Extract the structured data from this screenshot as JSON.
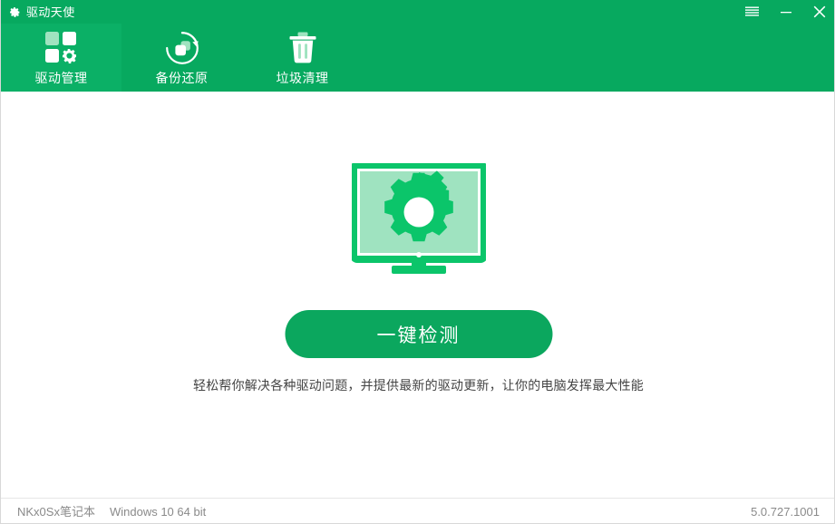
{
  "app": {
    "title": "驱动天使",
    "title_icon": "gear-icon",
    "accent_green": "#07a95f",
    "active_tab_green": "#0bb066",
    "button_green": "#0ba75e",
    "icon_bright_green": "#0bc56a",
    "icon_light_green": "#9fe3c0"
  },
  "window_controls": {
    "menu": "menu-icon",
    "minimize": "minimize-icon",
    "close": "close-icon"
  },
  "tabs": [
    {
      "label": "驱动管理",
      "icon": "driver-manage-icon",
      "active": true
    },
    {
      "label": "备份还原",
      "icon": "backup-restore-icon",
      "active": false
    },
    {
      "label": "垃圾清理",
      "icon": "trash-clean-icon",
      "active": false
    }
  ],
  "main": {
    "hero_icon": "monitor-gear-icon",
    "scan_button_label": "一键检测",
    "tagline": "轻松帮你解决各种驱动问题，并提供最新的驱动更新，让你的电脑发挥最大性能"
  },
  "footer": {
    "device_name": "NKx0Sx笔记本",
    "os": "Windows 10 64 bit",
    "version": "5.0.727.1001"
  }
}
